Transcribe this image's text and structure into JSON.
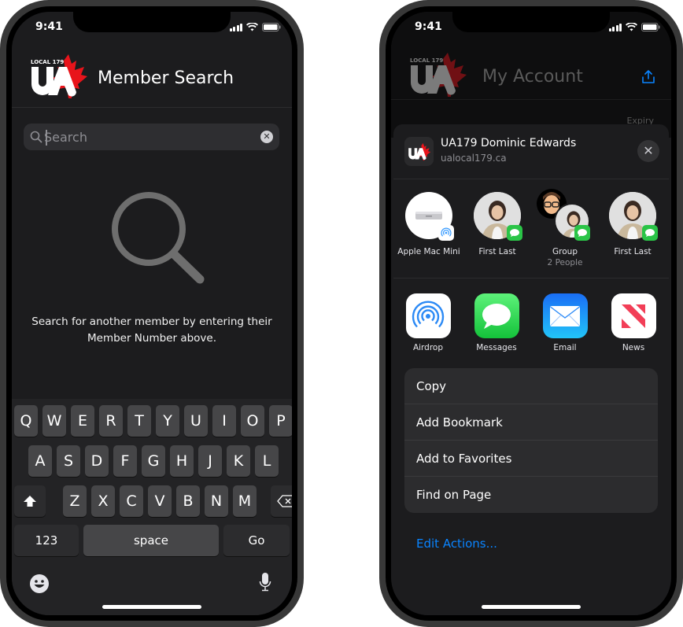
{
  "left_phone": {
    "status": {
      "time": "9:41"
    },
    "header": {
      "logo_text": "LOCAL 179",
      "logo_letters": "UA",
      "title": "Member Search"
    },
    "search": {
      "placeholder": "Search",
      "value": ""
    },
    "empty_state": {
      "message": "Search for another member by entering their Member Number above."
    },
    "keyboard": {
      "row1": [
        "Q",
        "W",
        "E",
        "R",
        "T",
        "Y",
        "U",
        "I",
        "O",
        "P"
      ],
      "row2": [
        "A",
        "S",
        "D",
        "F",
        "G",
        "H",
        "J",
        "K",
        "L"
      ],
      "row3": [
        "Z",
        "X",
        "C",
        "V",
        "B",
        "N",
        "M"
      ],
      "numbers_label": "123",
      "space_label": "space",
      "go_label": "Go"
    },
    "icons": {
      "shift": "shift-icon",
      "backspace": "backspace-icon",
      "emoji": "emoji-icon",
      "mic": "microphone-icon"
    }
  },
  "right_phone": {
    "status": {
      "time": "9:41"
    },
    "background_page": {
      "title": "My Account",
      "expiry_label": "Expiry"
    },
    "share_sheet": {
      "title": "UA179 Dominic Edwards",
      "subtitle": "ualocal179.ca",
      "people": [
        {
          "name": "Apple Mac Mini",
          "sub": "",
          "badge": "airdrop"
        },
        {
          "name": "First Last",
          "sub": "",
          "badge": "messages"
        },
        {
          "name": "Group",
          "sub": "2 People",
          "badge": "messages"
        },
        {
          "name": "First Last",
          "sub": "",
          "badge": "messages"
        }
      ],
      "apps": [
        {
          "label": "Airdrop",
          "icon": "airdrop-icon"
        },
        {
          "label": "Messages",
          "icon": "messages-icon"
        },
        {
          "label": "Email",
          "icon": "mail-icon"
        },
        {
          "label": "News",
          "icon": "news-icon"
        }
      ],
      "actions": [
        "Copy",
        "Add Bookmark",
        "Add to Favorites",
        "Find on Page"
      ],
      "edit_actions": "Edit Actions..."
    }
  },
  "colors": {
    "background": "#1c1c1e",
    "accent_blue": "#0a84ff",
    "brand_red": "#e8141b",
    "messages_green": "#2ac447"
  }
}
